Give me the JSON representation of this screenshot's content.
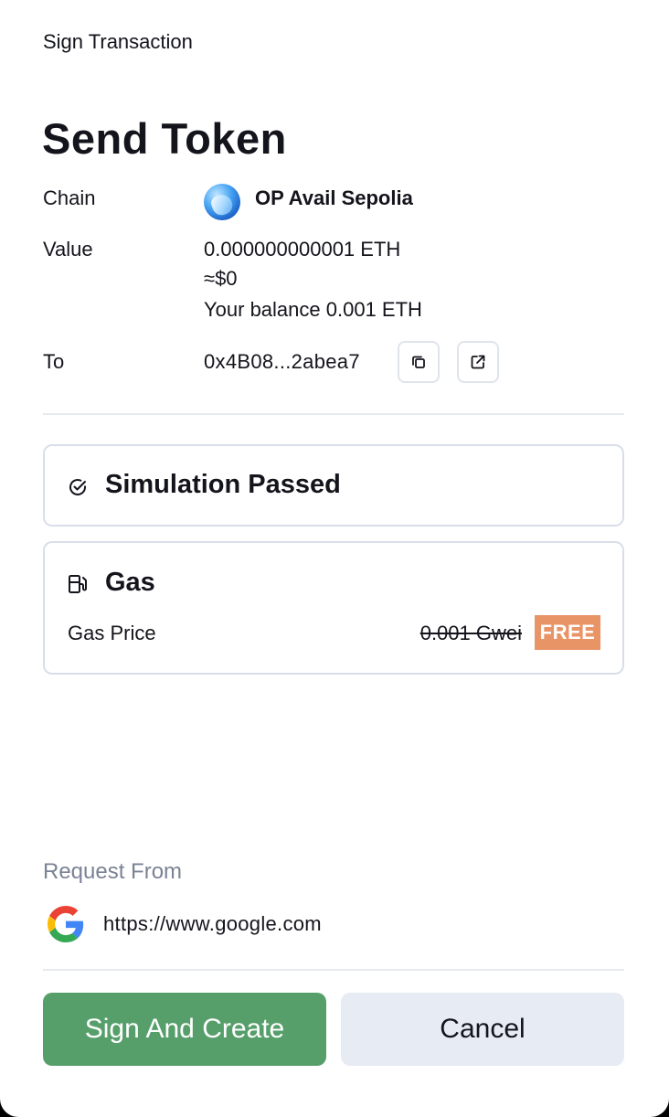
{
  "header": {
    "title": "Sign Transaction"
  },
  "main": {
    "title": "Send Token",
    "chain": {
      "label": "Chain",
      "value": "OP Avail Sepolia",
      "icon": "chain-logo-icon"
    },
    "value": {
      "label": "Value",
      "amount": "0.000000000001 ETH",
      "usd": "≈$0",
      "balance": "Your balance 0.001 ETH"
    },
    "to": {
      "label": "To",
      "address": "0x4B08...2abea7",
      "copy_icon": "copy-icon",
      "open_icon": "external-link-icon"
    }
  },
  "simulation": {
    "title": "Simulation Passed",
    "icon": "check-circle-icon"
  },
  "gas": {
    "title": "Gas",
    "icon": "fuel-pump-icon",
    "price_label": "Gas Price",
    "price_value": "0.001 Gwei",
    "badge": "FREE",
    "badge_color": "#e99466"
  },
  "request": {
    "label": "Request From",
    "url": "https://www.google.com",
    "icon": "google-icon"
  },
  "actions": {
    "confirm_label": "Sign And Create",
    "cancel_label": "Cancel",
    "confirm_color": "#569f6b",
    "cancel_color": "#e7ebf3"
  }
}
